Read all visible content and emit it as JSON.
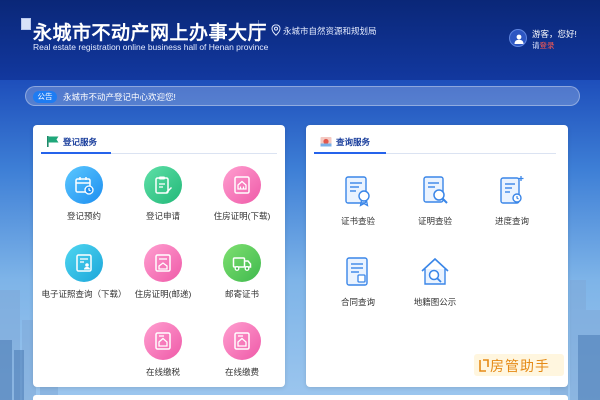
{
  "header": {
    "title": "永城市不动产网上办事大厅",
    "subtitle": "Real estate registration online business hall of Henan province",
    "location": "永城市自然资源和规划局",
    "greeting": "游客，您好!",
    "login_prefix": "请",
    "login_link": "登录"
  },
  "notice": {
    "tag": "公告",
    "text": "永城市不动产登记中心欢迎您!"
  },
  "registration": {
    "title": "登记服务",
    "items": [
      {
        "label": "登记预约",
        "icon": "calendar-clock-icon",
        "color": "#1d8ef0"
      },
      {
        "label": "登记申请",
        "icon": "clipboard-edit-icon",
        "color": "#22b878"
      },
      {
        "label": "住房证明(下载)",
        "icon": "house-certificate-icon",
        "color": "#ef5aa8"
      },
      {
        "label": "电子证照查询（下载）",
        "icon": "id-card-icon",
        "color": "#1ca6da"
      },
      {
        "label": "住房证明(邮递)",
        "icon": "house-mail-icon",
        "color": "#ef5aa8"
      },
      {
        "label": "邮寄证书",
        "icon": "delivery-truck-icon",
        "color": "#3fb94e"
      },
      {
        "label": "在线缴税",
        "icon": "tax-house-icon",
        "color": "#ef5aa8"
      },
      {
        "label": "在线缴费",
        "icon": "fee-house-icon",
        "color": "#ef5aa8"
      }
    ]
  },
  "query": {
    "title": "查询服务",
    "items": [
      {
        "label": "证书查验",
        "icon": "certificate-seal-icon"
      },
      {
        "label": "证明查验",
        "icon": "document-search-icon"
      },
      {
        "label": "进度查询",
        "icon": "progress-document-icon"
      },
      {
        "label": "合同查询",
        "icon": "contract-icon"
      },
      {
        "label": "地籍图公示",
        "icon": "house-search-icon"
      }
    ]
  },
  "watermark": {
    "text": "房管助手"
  },
  "colors": {
    "header_bg": "#0a2778",
    "accent": "#2563eb",
    "notice_tag": "#1e7cf2",
    "login_link": "#ff5a4e",
    "watermark_text": "#e58a16"
  }
}
